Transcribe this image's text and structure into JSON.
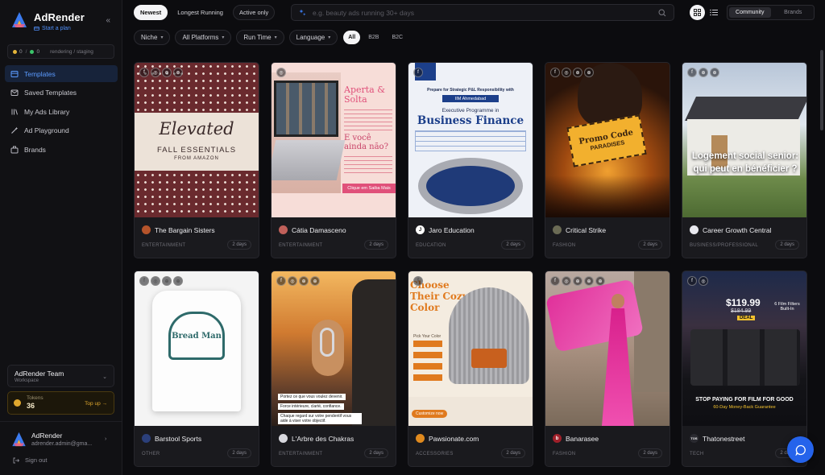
{
  "sidebar": {
    "brand": "AdRender",
    "brand_sub": "Start a plan",
    "status": {
      "a": "0",
      "sep": "/",
      "b": "0",
      "note": "rendering / staging"
    },
    "nav": [
      {
        "label": "Templates",
        "icon": "templates-icon",
        "active": true
      },
      {
        "label": "Saved Templates",
        "icon": "saved-icon"
      },
      {
        "label": "My Ads Library",
        "icon": "library-icon"
      },
      {
        "label": "Ad Playground",
        "icon": "playground-icon"
      },
      {
        "label": "Brands",
        "icon": "brands-icon"
      }
    ],
    "team": {
      "name": "AdRender Team",
      "sub": "Workspace"
    },
    "tokens": {
      "label": "Tokens",
      "value": "36",
      "topup": "Top up →"
    },
    "user": {
      "name": "AdRender",
      "email": "adrender.admin@gma..."
    },
    "signout": "Sign out"
  },
  "topbar": {
    "tabs": [
      "Newest",
      "Longest Running",
      "Active only"
    ],
    "search_placeholder": "e.g. beauty ads running 30+ days",
    "view": [
      "Community",
      "Brands"
    ]
  },
  "filters": {
    "dropdowns": [
      "Niche",
      "All Platforms",
      "Run Time",
      "Language"
    ],
    "audience": [
      "All",
      "B2B",
      "B2C"
    ]
  },
  "cards": [
    {
      "brand": "The Bargain Sisters",
      "category": "ENTERTAINMENT",
      "age": "2 days",
      "avatar_color": "#b5542b",
      "avatar_text": ""
    },
    {
      "brand": "Cátia Damasceno",
      "category": "ENTERTAINMENT",
      "age": "2 days",
      "avatar_color": "#c0605a",
      "avatar_text": ""
    },
    {
      "brand": "Jaro Education",
      "category": "EDUCATION",
      "age": "2 days",
      "avatar_color": "#ffffff",
      "avatar_text": "J"
    },
    {
      "brand": "Critical Strike",
      "category": "FASHION",
      "age": "2 days",
      "avatar_color": "#6b6b55",
      "avatar_text": ""
    },
    {
      "brand": "Career Growth Central",
      "category": "BUSINESS/PROFESSIONAL",
      "age": "2 days",
      "avatar_color": "#e8e8ee",
      "avatar_text": ""
    },
    {
      "brand": "Barstool Sports",
      "category": "OTHER",
      "age": "2 days",
      "avatar_color": "#2b3f7a",
      "avatar_text": ""
    },
    {
      "brand": "L'Arbre des Chakras",
      "category": "ENTERTAINMENT",
      "age": "2 days",
      "avatar_color": "#d8d8de",
      "avatar_text": ""
    },
    {
      "brand": "Pawsionate.com",
      "category": "ACCESSORIES",
      "age": "2 days",
      "avatar_color": "#e08a1e",
      "avatar_text": ""
    },
    {
      "brand": "Banarasee",
      "category": "FASHION",
      "age": "2 days",
      "avatar_color": "#a0202a",
      "avatar_text": "b"
    },
    {
      "brand": "Thatonestreet",
      "category": "TECH",
      "age": "2 days",
      "avatar_color": "#2a2a30",
      "avatar_text": "TOS"
    }
  ],
  "thumbs": {
    "c1_title": "Elevated",
    "c1_sub": "FALL ESSENTIALS",
    "c1_from": "FROM AMAZON",
    "c2_head": "Aperta & Solta",
    "c2_q": "E você ainda não?",
    "c2_cta": "Clique em Saiba Mais",
    "c3_top": "Prepare for Strategic P&L Responsibility with",
    "c3_iim": "IIM Ahmedabad",
    "c3_prog": "Executive Programme in",
    "c3_title": "Business Finance",
    "c4_promo": "Promo Code",
    "c4_code": "PARADISES",
    "c5_text": "Logement social senior: qui peut en bénéficier ?",
    "c6_shirt": "Bread Man",
    "c7_lines": [
      "Portez ce que vous voulez devenir.",
      "Force intérieure, clarté, confiance.",
      "Chaque regard sur votre pendentif vous aide à viser votre objectif."
    ],
    "c8_title": "Choose Their Cozy Color",
    "c8_pick": "Pick Your Color",
    "c8_cta": "Customize now",
    "c10_price": "$119.99",
    "c10_old": "$184.99",
    "c10_deal": "DEAL",
    "c10_film": "6 Film Filters Built-In",
    "c10_stop": "STOP PAYING FOR FILM FOR GOOD",
    "c10_guarantee": "60-Day Money-Back Guarantee"
  }
}
